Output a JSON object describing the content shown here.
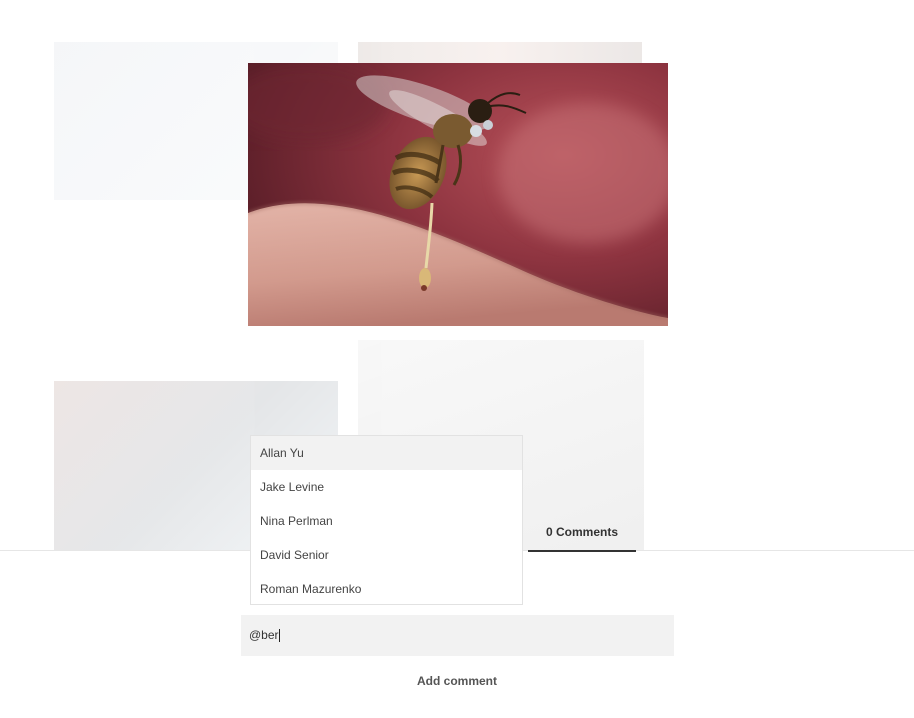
{
  "background": {
    "nav_left": "",
    "nav_center": "",
    "nav_right": "",
    "caption": ""
  },
  "photo": {
    "subject": "bee stinging skin"
  },
  "comments": {
    "count": "0",
    "tab_label": "Comments",
    "input_value": "@ber",
    "add_label": "Add comment"
  },
  "mentions": {
    "active_index": 0,
    "items": [
      {
        "label": "Allan Yu"
      },
      {
        "label": "Jake Levine"
      },
      {
        "label": "Nina Perlman"
      },
      {
        "label": "David Senior"
      },
      {
        "label": "Roman Mazurenko"
      }
    ]
  },
  "colors": {
    "tab_underline": "#333333",
    "input_bg": "#f2f2f2",
    "active_item_bg": "#f2f2f2"
  }
}
